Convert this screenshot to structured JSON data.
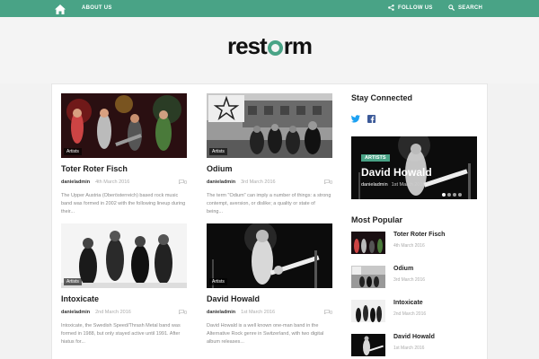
{
  "nav": {
    "about": "ABOUT US",
    "follow": "FOLLOW US",
    "search": "SEARCH"
  },
  "logo": {
    "pre": "rest",
    "post": "rm"
  },
  "posts": [
    {
      "category": "Artists",
      "title": "Toter Roter Fisch",
      "author": "danieladmin",
      "date": "4th March 2016",
      "comments": "0",
      "excerpt": "The Upper Austria (Oberösterreich) based rock music band was formed in 2002 with the following lineup during their..."
    },
    {
      "category": "Artists",
      "title": "Odium",
      "author": "danieladmin",
      "date": "3rd March 2016",
      "comments": "0",
      "excerpt": "The term \"Odium\" can imply a number of things: a strong contempt, aversion, or dislike; a quality or state of being..."
    },
    {
      "category": "Artists",
      "title": "Intoxicate",
      "author": "danieladmin",
      "date": "2nd March 2016",
      "comments": "0",
      "excerpt": "Intoxicate, the Swedish Speed/Thrash Metal band was formed in 1988, but only stayed active until 1991. After hiatus for..."
    },
    {
      "category": "Artists",
      "title": "David Howald",
      "author": "danieladmin",
      "date": "1st March 2016",
      "comments": "0",
      "excerpt": "David Howald is a well known one-man band in the Alternative Rock genre in Switzerland, with two digital album releases..."
    }
  ],
  "sidebar": {
    "stay_connected": "Stay Connected",
    "featured": {
      "tag": "ARTISTS",
      "title": "David Howald",
      "author": "danieladmin",
      "date": "1st March 2016"
    },
    "most_popular": "Most Popular",
    "popular": [
      {
        "title": "Toter Roter Fisch",
        "date": "4th March 2016"
      },
      {
        "title": "Odium",
        "date": "3rd March 2016"
      },
      {
        "title": "Intoxicate",
        "date": "2nd March 2016"
      },
      {
        "title": "David Howald",
        "date": "1st March 2016"
      }
    ]
  },
  "colors": {
    "accent": "#49a386",
    "twitter": "#1da1f2",
    "facebook": "#3b5998"
  }
}
